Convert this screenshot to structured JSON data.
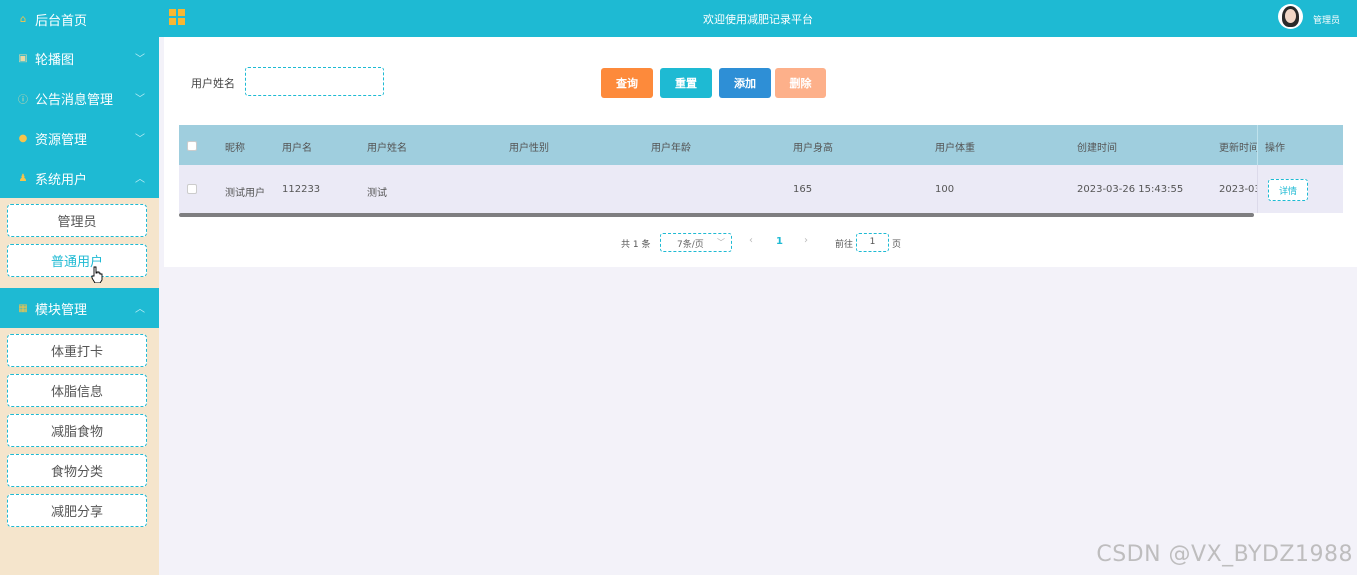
{
  "header": {
    "title": "欢迎使用减肥记录平台",
    "username": "管理员"
  },
  "sidebar": {
    "home": "后台首页",
    "carousel": "轮播图",
    "notice": "公告消息管理",
    "resource": "资源管理",
    "users": "系统用户",
    "users_items": [
      "管理员",
      "普通用户"
    ],
    "modules": "模块管理",
    "modules_items": [
      "体重打卡",
      "体脂信息",
      "减脂食物",
      "食物分类",
      "减肥分享"
    ]
  },
  "search": {
    "label": "用户姓名",
    "value": "",
    "buttons": {
      "query": "查询",
      "reset": "重置",
      "add": "添加",
      "delete": "删除"
    }
  },
  "table": {
    "columns": [
      "昵称",
      "用户名",
      "用户姓名",
      "用户性别",
      "用户年龄",
      "用户身高",
      "用户体重",
      "创建时间",
      "更新时间",
      "操作"
    ],
    "rows": [
      {
        "nickname": "测试用户",
        "username": "112233",
        "realname": "测试",
        "gender": "",
        "age": "",
        "height": "165",
        "weight": "100",
        "created": "2023-03-26 15:43:55",
        "updated": "2023-03-",
        "action": "详情"
      }
    ]
  },
  "pagination": {
    "total": "共 1 条",
    "page_size": "7条/页",
    "current": "1",
    "goto_label": "前往",
    "goto_value": "1",
    "goto_suffix": "页"
  },
  "watermark": "CSDN @VX_BYDZ1988",
  "colors": {
    "primary": "#1ebad3",
    "query": "#fd8a3b",
    "add": "#2e8fd6",
    "delete": "#fdb08a",
    "sidebar_bg": "#f5e5cc"
  }
}
